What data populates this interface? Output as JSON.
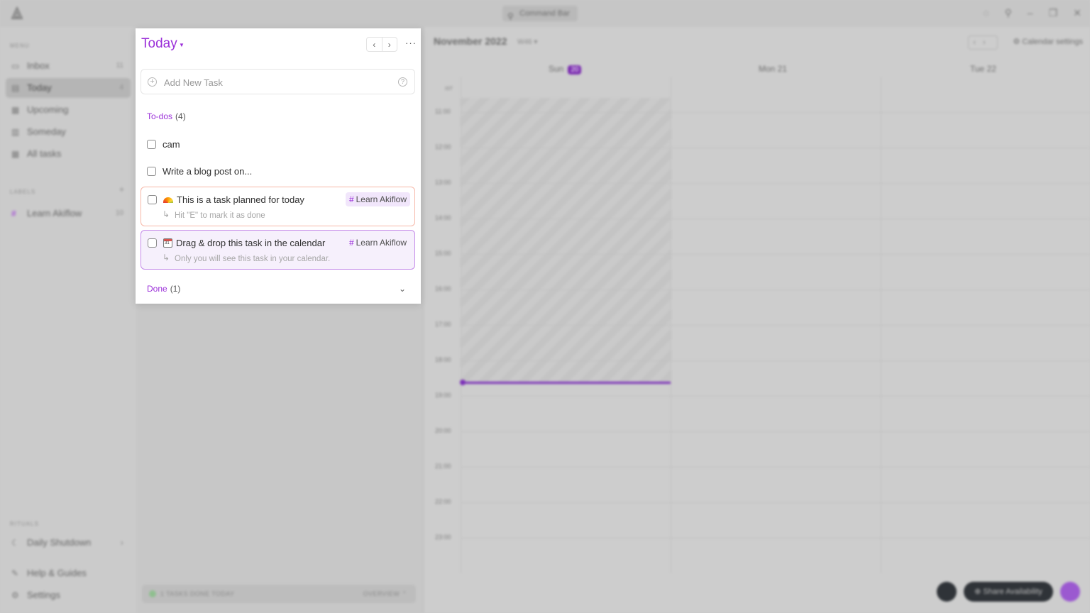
{
  "titlebar": {
    "command_bar": "Command Bar"
  },
  "sidebar": {
    "menu_label": "MENU",
    "items": [
      {
        "label": "Inbox",
        "count": "11"
      },
      {
        "label": "Today",
        "count": "4"
      },
      {
        "label": "Upcoming",
        "count": ""
      },
      {
        "label": "Someday",
        "count": ""
      },
      {
        "label": "All tasks",
        "count": ""
      }
    ],
    "labels_label": "LABELS",
    "labels": [
      {
        "label": "Learn Akiflow",
        "count": "10"
      }
    ],
    "rituals_label": "RITUALS",
    "rituals": [
      {
        "label": "Daily Shutdown"
      }
    ],
    "footer": [
      {
        "label": "Help & Guides"
      },
      {
        "label": "Settings"
      }
    ]
  },
  "middle": {
    "tasks_done": "1 TASKS DONE TODAY",
    "overview": "OVERVIEW"
  },
  "calendar": {
    "title": "November 2022",
    "week": "W46",
    "settings": "Calendar settings",
    "days": [
      {
        "name": "Sun",
        "badge": "20"
      },
      {
        "name": "Mon",
        "badge": "21"
      },
      {
        "name": "Tue",
        "badge": "22"
      }
    ],
    "tz": "IST",
    "hours": [
      "11:00",
      "12:00",
      "13:00",
      "14:00",
      "15:00",
      "16:00",
      "17:00",
      "18:00",
      "19:00",
      "20:00",
      "21:00",
      "22:00",
      "23:00"
    ],
    "share": "Share Availability"
  },
  "today": {
    "title": "Today",
    "add_task_placeholder": "Add New Task",
    "todos_label": "To-dos",
    "todos_count": "(4)",
    "tasks": [
      {
        "title": "cam"
      },
      {
        "title": "Write a blog post on..."
      },
      {
        "title": "This is a task planned for today",
        "emoji": "rainbow",
        "label": "Learn Akiflow",
        "subtitle": "Hit \"E\" to mark it as done"
      },
      {
        "title": "Drag & drop this task in the calendar",
        "emoji": "calendar",
        "label": "Learn Akiflow",
        "subtitle": "Only you will see this task in your calendar."
      }
    ],
    "done_label": "Done",
    "done_count": "(1)"
  },
  "colors": {
    "accent": "#9b30d9",
    "card1_border": "#f7b7a8",
    "card2_border": "#c58be9"
  }
}
